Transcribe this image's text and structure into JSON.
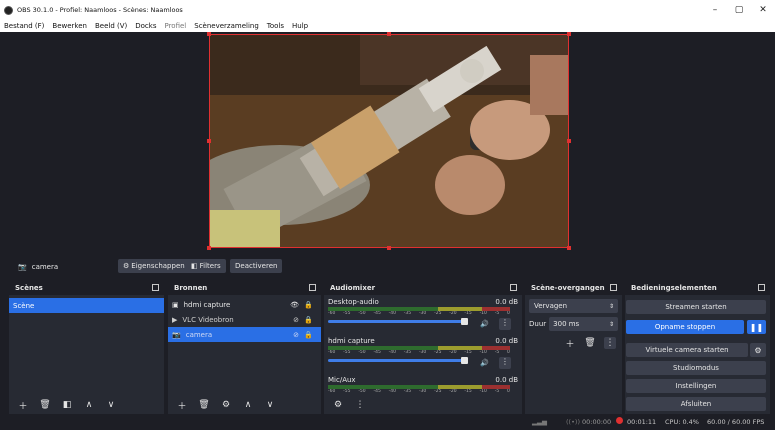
{
  "window": {
    "title": "OBS 30.1.0 - Profiel: Naamloos - Scènes: Naamloos",
    "minimize": "–",
    "maximize": "▢",
    "close": "✕"
  },
  "menu": {
    "items": [
      "Bestand (F)",
      "Bewerken",
      "Beeld (V)",
      "Docks",
      "Profiel",
      "Scèneverzameling",
      "Tools",
      "Hulp"
    ]
  },
  "context": {
    "source_name": "camera",
    "properties_label": "Eigenschappen",
    "filters_label": "Filters",
    "deactivate_label": "Deactiveren"
  },
  "scenes": {
    "title": "Scènes",
    "items": [
      "Scène"
    ]
  },
  "sources": {
    "title": "Bronnen",
    "items": [
      {
        "label": "hdmi capture",
        "icon": "monitor-icon"
      },
      {
        "label": "VLC Videobron",
        "icon": "play-icon"
      },
      {
        "label": "camera",
        "icon": "camera-icon"
      }
    ]
  },
  "mixer": {
    "title": "Audiomixer",
    "ticks": [
      "-60",
      "-55",
      "-50",
      "-45",
      "-40",
      "-35",
      "-30",
      "-25",
      "-20",
      "-15",
      "-10",
      "-5",
      "0"
    ],
    "channels": [
      {
        "name": "Desktop-audio",
        "level": "0.0 dB"
      },
      {
        "name": "hdmi capture",
        "level": "0.0 dB"
      },
      {
        "name": "Mic/Aux",
        "level": "0.0 dB"
      }
    ]
  },
  "transitions": {
    "title": "Scène-overgangen",
    "type_value": "Vervagen",
    "duration_label": "Duur",
    "duration_value": "300 ms"
  },
  "controls": {
    "title": "Bedieningselementen",
    "stream": "Streamen starten",
    "record": "Opname stoppen",
    "virtual_cam": "Virtuele camera starten",
    "studio": "Studiomodus",
    "settings": "Instellingen",
    "exit": "Afsluiten"
  },
  "status": {
    "stream_time": "00:00:00",
    "rec_time": "00:01:11",
    "cpu": "CPU: 0.4%",
    "fps": "60.00 / 60.00 FPS"
  },
  "colors": {
    "accent": "#2a6fe5",
    "record_red": "#e03030",
    "panel": "#272a33",
    "background": "#1d1e25"
  }
}
